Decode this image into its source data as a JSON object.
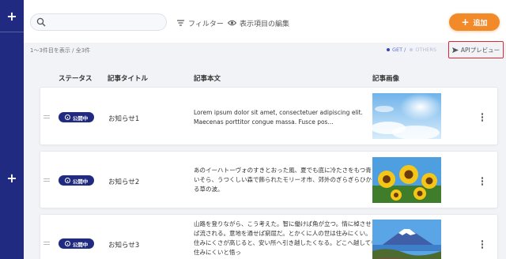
{
  "header": {
    "search_placeholder": "",
    "filter_label": "フィルター",
    "columns_label": "表示項目の編集",
    "add_label": "追加"
  },
  "summary": {
    "count_text": "1〜3件目を表示 / 全3件",
    "api_get": "GET",
    "api_sep": "/",
    "api_others": "OTHERS",
    "api_preview_label": "APIプレビュー"
  },
  "columns": {
    "status": "ステータス",
    "title": "記事タイトル",
    "body": "記事本文",
    "image": "記事画像"
  },
  "rows": [
    {
      "status": "公開中",
      "title": "お知らせ1",
      "body": "Lorem ipsum dolor sit amet, consectetuer adipiscing elit. Maecenas porttitor congue massa. Fusce pos...",
      "image_icon": "sky-clouds-image"
    },
    {
      "status": "公開中",
      "title": "お知らせ2",
      "body": "あのイーハトーヴォのすきとおった風、夏でも底に冷たさをもつ青いそら、うつくしい森で飾られたモリーオ市、郊外のぎらぎらひかる草の波。",
      "image_icon": "sunflowers-image"
    },
    {
      "status": "公開中",
      "title": "お知らせ3",
      "body": "山路を登りながら、こう考えた。智に働けば角が立つ。情に棹させば流される。意地を通せば窮屈だ。とかくに人の世は住みにくい。住みにくさが高じると、安い所へ引き越したくなる。どこへ越しても住みにくいと悟っ",
      "image_icon": "mount-fuji-image"
    }
  ],
  "colors": {
    "sidebar": "#1f2a80",
    "accent_orange": "#f28a2a",
    "badge": "#1f2a80",
    "highlight_border": "#e0262f"
  }
}
